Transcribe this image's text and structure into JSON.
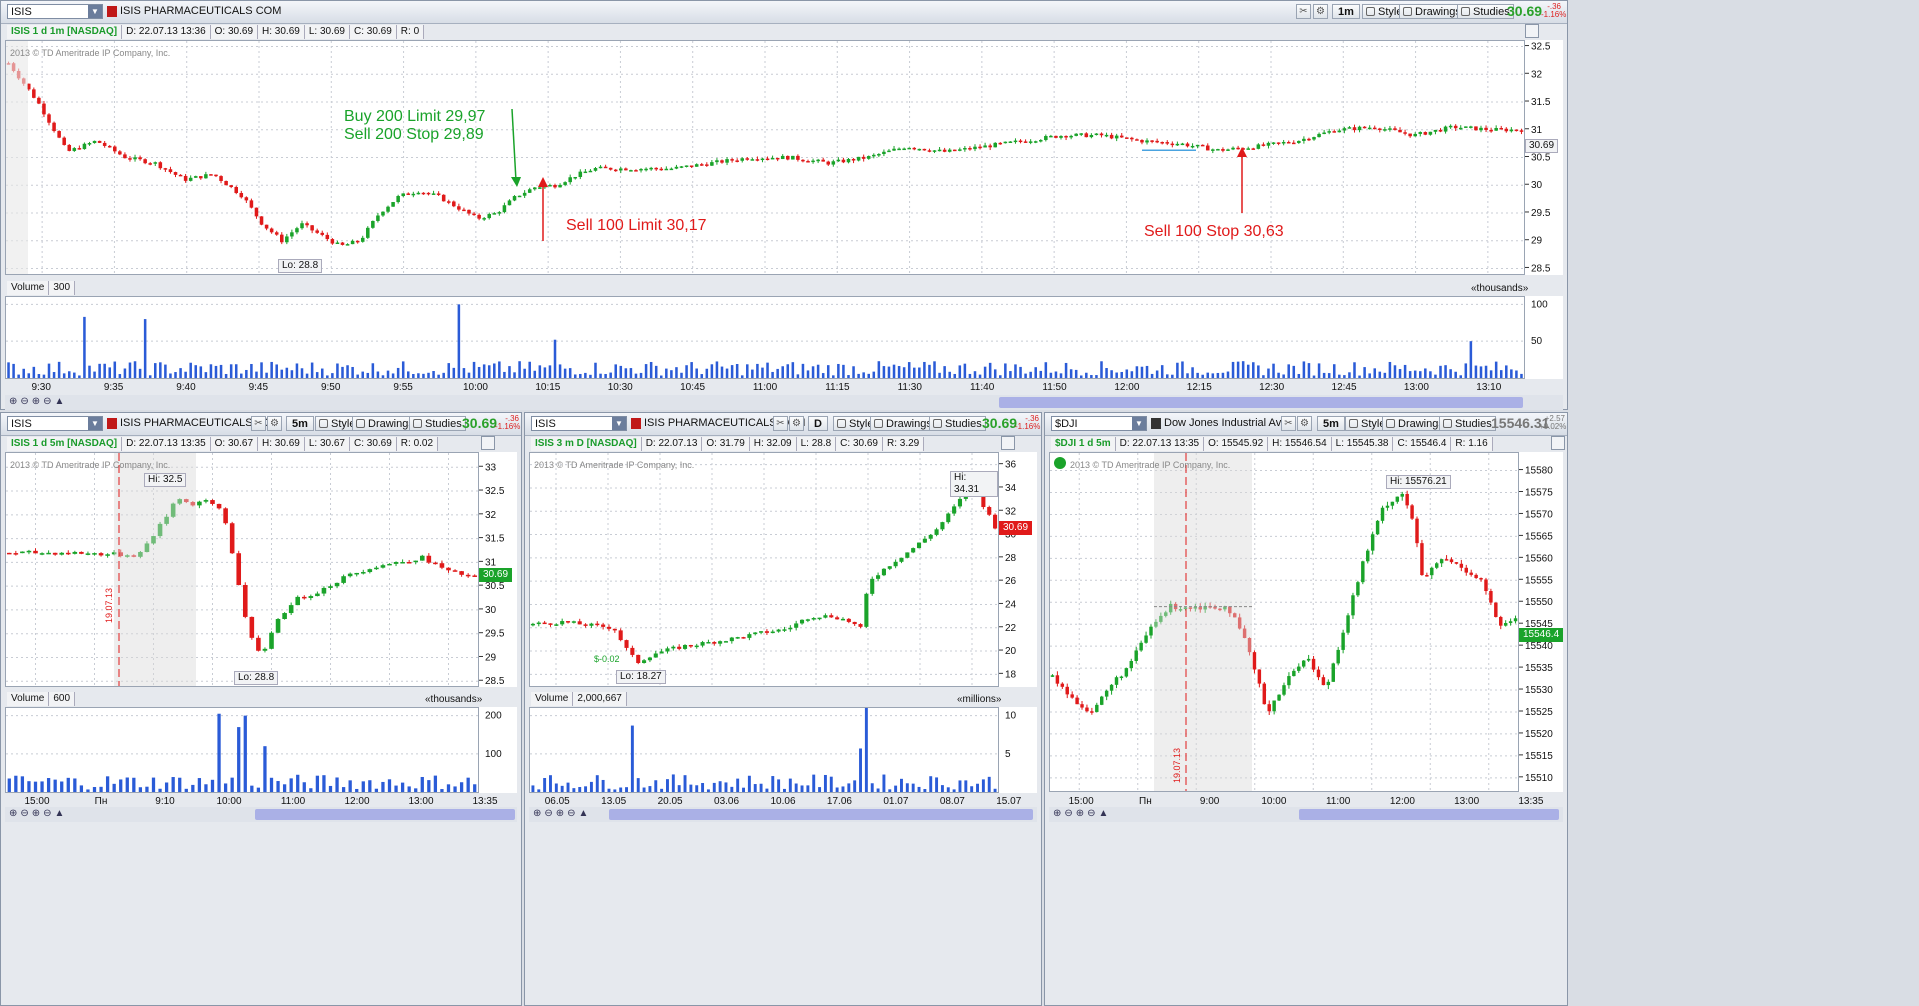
{
  "top": {
    "symbol": "ISIS",
    "company": "ISIS PHARMACEUTICALS COM",
    "interval_btn": "1m",
    "style": "Style",
    "drawings": "Drawings",
    "studies": "Studies",
    "last": "30.69",
    "chg_abs": "-.36",
    "chg_pct": "-1.16%",
    "info": {
      "name": "ISIS 1 d 1m [NASDAQ]",
      "d": "D: 22.07.13 13:36",
      "o": "O: 30.69",
      "h": "H: 30.69",
      "l": "L: 30.69",
      "c": "C: 30.69",
      "r": "R: 0"
    },
    "copyright": "2013 © TD Ameritrade IP Company, Inc.",
    "lo_label": "Lo: 28.8",
    "price_tag": "30.69",
    "volume_label": "Volume",
    "volume_value": "300",
    "volume_unit": "«thousands»",
    "annotations": {
      "buy1": "Buy 200 Limit 29,97",
      "buy2": "Sell 200 Stop 29,89",
      "sell_limit": "Sell 100 Limit 30,17",
      "sell_stop": "Sell 100 Stop 30,63"
    },
    "colors": {
      "green": "#1aa32a",
      "red": "#e01a1a",
      "vol": "#2a5bd7"
    }
  },
  "bl": {
    "symbol": "ISIS",
    "company": "ISIS PHARMACEUTICALS COM",
    "interval_btn": "5m",
    "style": "Style",
    "drawings": "Drawings",
    "studies": "Studies",
    "last": "30.69",
    "chg_abs": "-.36",
    "chg_pct": "-1.16%",
    "info": {
      "name": "ISIS 1 d 5m [NASDAQ]",
      "d": "D: 22.07.13 13:35",
      "o": "O: 30.67",
      "h": "H: 30.69",
      "l": "L: 30.67",
      "c": "C: 30.69",
      "r": "R: 0.02"
    },
    "copyright": "2013 © TD Ameritrade IP Company, Inc.",
    "hi_label": "Hi: 32.5",
    "lo_label": "Lo: 28.8",
    "price_tag": "30.69",
    "date_mark": "19.07.13",
    "volume_label": "Volume",
    "volume_value": "600",
    "volume_unit": "«thousands»"
  },
  "bm": {
    "symbol": "ISIS",
    "company": "ISIS PHARMACEUTICALS COM",
    "interval_btn": "D",
    "style": "Style",
    "drawings": "Drawings",
    "studies": "Studies",
    "last": "30.69",
    "chg_abs": "-.36",
    "chg_pct": "-1.16%",
    "info": {
      "name": "ISIS 3 m D [NASDAQ]",
      "d": "D: 22.07.13",
      "o": "O: 31.79",
      "h": "H: 32.09",
      "l": "L: 28.8",
      "c": "C: 30.69",
      "r": "R: 3.29"
    },
    "copyright": "2013 © TD Ameritrade IP Company, Inc.",
    "hi_label": "Hi: 34.31",
    "lo_label": "Lo: 18.27",
    "div_label": "$-0.02",
    "price_tag": "30.69",
    "volume_label": "Volume",
    "volume_value": "2,000,667",
    "volume_unit": "«millions»"
  },
  "br": {
    "symbol": "$DJI",
    "company": "Dow Jones Industrial Ave...",
    "interval_btn": "5m",
    "style": "Style",
    "drawings": "Drawings",
    "studies": "Studies",
    "last": "15546.31",
    "chg_abs": "+2.57",
    "chg_pct": "+0.02%",
    "info": {
      "name": "$DJI 1 d 5m",
      "d": "D: 22.07.13 13:35",
      "o": "O: 15545.92",
      "h": "H: 15546.54",
      "l": "L: 15545.38",
      "c": "C: 15546.4",
      "r": "R: 1.16"
    },
    "copyright": "2013 © TD Ameritrade IP Company, Inc.",
    "hi_label": "Hi: 15576.21",
    "price_tag": "15546.4",
    "date_mark": "19.07.13"
  },
  "chart_data": [
    {
      "type": "candlestick",
      "title": "ISIS 1 d 1m [NASDAQ]",
      "ylim": [
        28.4,
        32.6
      ],
      "y_ticks": [
        "28.5",
        "29",
        "29.5",
        "30",
        "30.5",
        "31",
        "31.5",
        "32",
        "32.5"
      ],
      "x_ticks": [
        "9:30",
        "9:35",
        "9:40",
        "9:45",
        "9:50",
        "9:55",
        "10:00",
        "10:15",
        "10:30",
        "10:45",
        "11:00",
        "11:15",
        "11:30",
        "11:40",
        "11:50",
        "12:00",
        "12:15",
        "12:30",
        "12:45",
        "13:00",
        "13:10"
      ],
      "close_path": [
        [
          0,
          32.2
        ],
        [
          3,
          31.5
        ],
        [
          6,
          30.6
        ],
        [
          9,
          30.8
        ],
        [
          12,
          30.5
        ],
        [
          15,
          30.4
        ],
        [
          18,
          30.1
        ],
        [
          21,
          30.2
        ],
        [
          24,
          29.8
        ],
        [
          26,
          29.3
        ],
        [
          28,
          29.0
        ],
        [
          30,
          29.3
        ],
        [
          32,
          29.1
        ],
        [
          34,
          28.9
        ],
        [
          36,
          29.0
        ],
        [
          38,
          29.5
        ],
        [
          40,
          29.8
        ],
        [
          42,
          29.9
        ],
        [
          44,
          29.8
        ],
        [
          46,
          29.6
        ],
        [
          48,
          29.4
        ],
        [
          50,
          29.5
        ],
        [
          52,
          29.8
        ],
        [
          54,
          29.97
        ],
        [
          56,
          30.0
        ],
        [
          58,
          30.17
        ],
        [
          60,
          30.3
        ],
        [
          64,
          30.3
        ],
        [
          68,
          30.3
        ],
        [
          72,
          30.4
        ],
        [
          76,
          30.5
        ],
        [
          80,
          30.5
        ],
        [
          84,
          30.4
        ],
        [
          88,
          30.5
        ],
        [
          92,
          30.7
        ],
        [
          96,
          30.6
        ],
        [
          100,
          30.7
        ],
        [
          104,
          30.8
        ],
        [
          108,
          30.9
        ],
        [
          112,
          30.9
        ],
        [
          116,
          30.8
        ],
        [
          120,
          30.75
        ],
        [
          124,
          30.63
        ],
        [
          128,
          30.7
        ],
        [
          132,
          30.8
        ],
        [
          136,
          31.0
        ],
        [
          140,
          31.05
        ],
        [
          144,
          30.9
        ],
        [
          148,
          31.05
        ],
        [
          152,
          31.0
        ],
        [
          155,
          31.0
        ]
      ],
      "volume_ylim": [
        0,
        110
      ],
      "volume_ticks": [
        "50",
        "100"
      ],
      "volume_spikes": [
        [
          8,
          83
        ],
        [
          14,
          80
        ],
        [
          46,
          100
        ],
        [
          56,
          52
        ],
        [
          150,
          50
        ]
      ]
    },
    {
      "type": "candlestick",
      "title": "ISIS 1 d 5m [NASDAQ]",
      "ylim": [
        28.4,
        33.3
      ],
      "y_ticks": [
        "28.5",
        "29",
        "29.5",
        "30",
        "30.5",
        "31",
        "31.5",
        "32",
        "32.5",
        "33"
      ],
      "x_ticks": [
        "15:00",
        "Пн",
        "9:10",
        "10:00",
        "11:00",
        "12:00",
        "13:00",
        "13:35"
      ],
      "close_path": [
        [
          0,
          31.2
        ],
        [
          10,
          31.2
        ],
        [
          20,
          31.15
        ],
        [
          24,
          31.9
        ],
        [
          26,
          32.4
        ],
        [
          28,
          32.2
        ],
        [
          30,
          32.3
        ],
        [
          33,
          32.1
        ],
        [
          35,
          30.9
        ],
        [
          37,
          29.5
        ],
        [
          39,
          29.0
        ],
        [
          41,
          29.7
        ],
        [
          44,
          30.2
        ],
        [
          48,
          30.4
        ],
        [
          52,
          30.7
        ],
        [
          56,
          30.9
        ],
        [
          60,
          31.0
        ],
        [
          64,
          31.1
        ],
        [
          68,
          30.8
        ],
        [
          72,
          30.69
        ]
      ],
      "volume_ylim": [
        0,
        220
      ],
      "volume_ticks": [
        "100",
        "200"
      ],
      "volume_spikes": [
        [
          32,
          205
        ],
        [
          35,
          170
        ],
        [
          37,
          200
        ],
        [
          40,
          120
        ]
      ]
    },
    {
      "type": "candlestick",
      "title": "ISIS 3 m D [NASDAQ]",
      "ylim": [
        17,
        37
      ],
      "y_ticks": [
        "18",
        "20",
        "22",
        "24",
        "26",
        "28",
        "30",
        "32",
        "34",
        "36"
      ],
      "x_ticks": [
        "06.05",
        "13.05",
        "20.05",
        "03.06",
        "10.06",
        "17.06",
        "01.07",
        "08.07",
        "15.07"
      ],
      "close_path": [
        [
          0,
          22.3
        ],
        [
          5,
          22.5
        ],
        [
          10,
          22.2
        ],
        [
          14,
          22.0
        ],
        [
          16,
          20.3
        ],
        [
          18,
          19.0
        ],
        [
          21,
          19.8
        ],
        [
          26,
          20.4
        ],
        [
          30,
          20.7
        ],
        [
          35,
          21.1
        ],
        [
          40,
          21.6
        ],
        [
          44,
          21.9
        ],
        [
          48,
          23.0
        ],
        [
          52,
          23.0
        ],
        [
          55,
          22.5
        ],
        [
          57,
          21.8
        ],
        [
          58,
          26.0
        ],
        [
          62,
          27.5
        ],
        [
          66,
          28.9
        ],
        [
          70,
          30.5
        ],
        [
          74,
          33.0
        ],
        [
          76,
          34.3
        ],
        [
          78,
          32.5
        ],
        [
          80,
          30.7
        ]
      ],
      "volume_ylim": [
        0,
        11
      ],
      "volume_ticks": [
        "5",
        "10"
      ],
      "volume_spikes": [
        [
          17,
          8.7
        ],
        [
          58,
          11
        ],
        [
          57,
          5.7
        ]
      ]
    },
    {
      "type": "candlestick",
      "title": "$DJI 1 d 5m",
      "ylim": [
        15507,
        15584
      ],
      "y_ticks": [
        "15510",
        "15515",
        "15520",
        "15525",
        "15530",
        "15535",
        "15540",
        "15545",
        "15550",
        "15555",
        "15560",
        "15565",
        "15570",
        "15575",
        "15580"
      ],
      "x_ticks": [
        "15:00",
        "Пн",
        "9:00",
        "10:00",
        "11:00",
        "12:00",
        "13:00",
        "13:35"
      ],
      "close_path": [
        [
          0,
          15533
        ],
        [
          4,
          15528
        ],
        [
          8,
          15525
        ],
        [
          12,
          15531
        ],
        [
          16,
          15536
        ],
        [
          20,
          15544
        ],
        [
          24,
          15549
        ],
        [
          28,
          15549
        ],
        [
          32,
          15549
        ],
        [
          36,
          15549
        ],
        [
          40,
          15540
        ],
        [
          44,
          15525
        ],
        [
          48,
          15532
        ],
        [
          52,
          15538
        ],
        [
          56,
          15530
        ],
        [
          60,
          15545
        ],
        [
          64,
          15560
        ],
        [
          68,
          15572
        ],
        [
          72,
          15575
        ],
        [
          74,
          15568
        ],
        [
          76,
          15555
        ],
        [
          80,
          15560
        ],
        [
          84,
          15558
        ],
        [
          88,
          15555
        ],
        [
          92,
          15544
        ],
        [
          95,
          15546.4
        ]
      ]
    }
  ]
}
